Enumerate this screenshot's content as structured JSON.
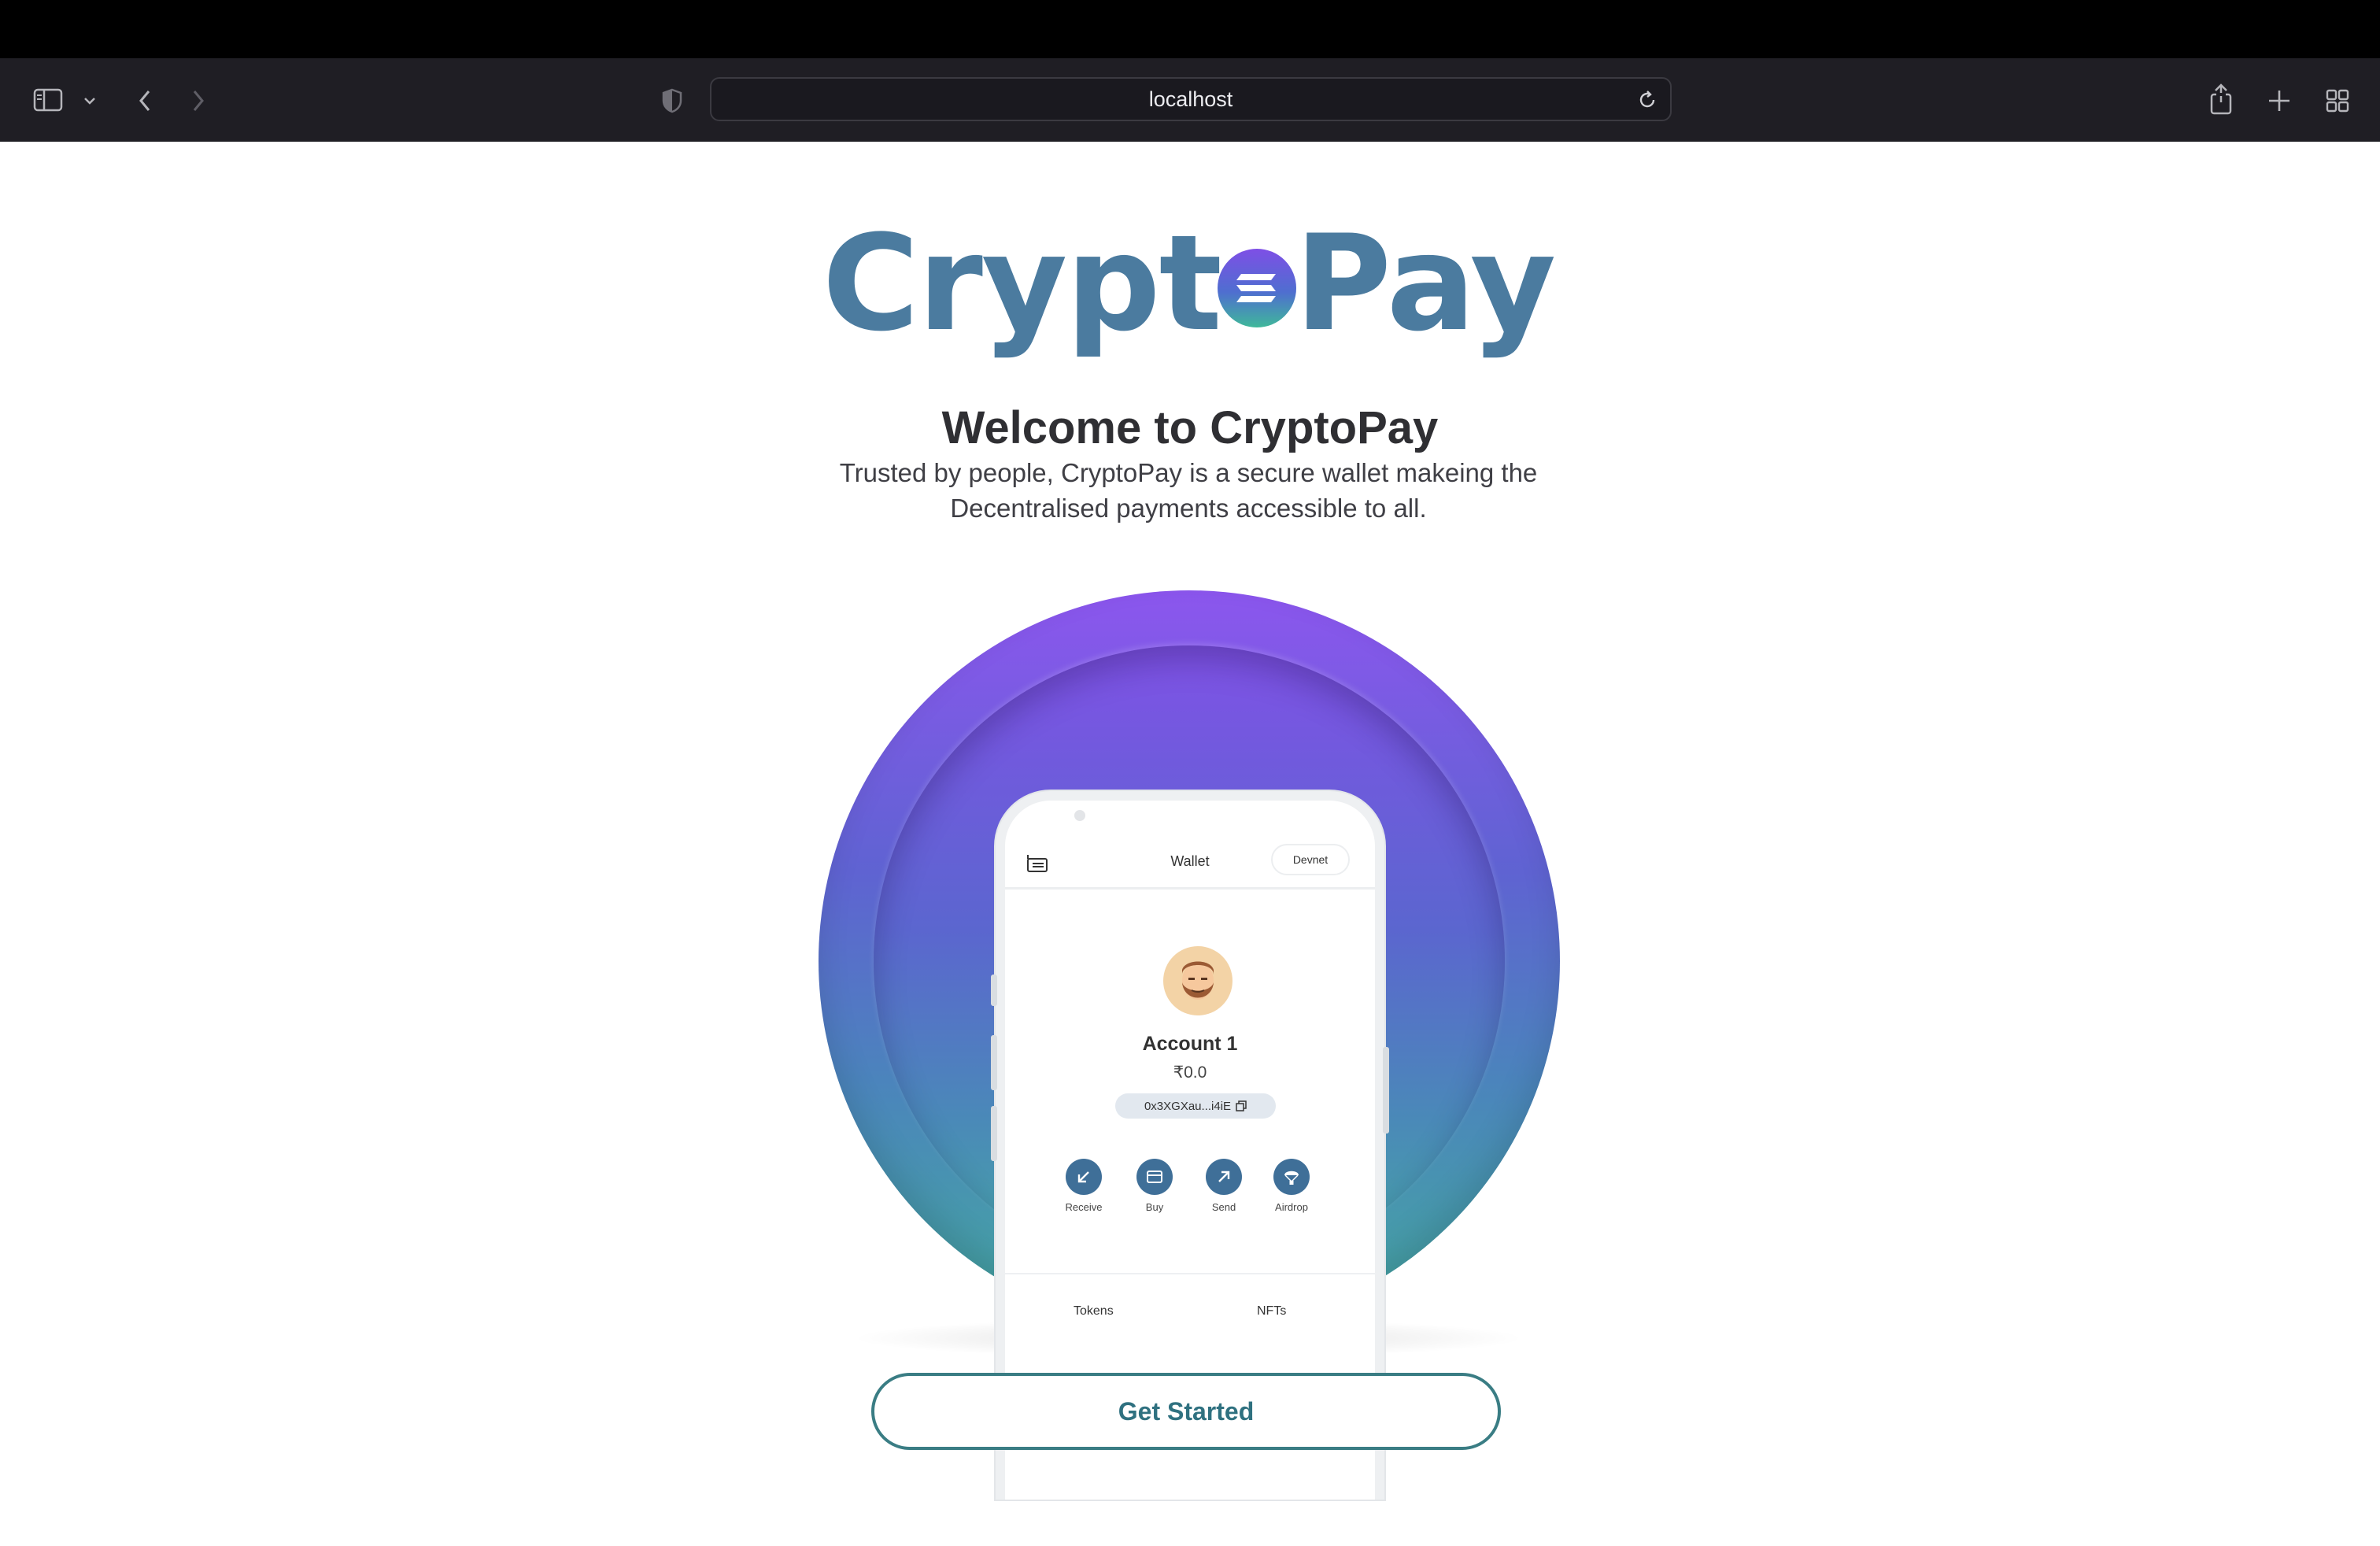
{
  "browser": {
    "address": "localhost"
  },
  "hero": {
    "logo_left": "Crypt",
    "logo_right": "Pay",
    "title": "Welcome to CryptoPay",
    "subtitle_line1": "Trusted by people, CryptoPay is a secure wallet makeing the",
    "subtitle_line2": "Decentralised payments accessible to all."
  },
  "phone": {
    "title": "Wallet",
    "network": "Devnet",
    "account_name": "Account 1",
    "balance": "₹0.0",
    "address": "0x3XGXau...i4iE",
    "actions": [
      {
        "label": "Receive",
        "icon": "arrow-down-left-icon"
      },
      {
        "label": "Buy",
        "icon": "card-icon"
      },
      {
        "label": "Send",
        "icon": "arrow-up-right-icon"
      },
      {
        "label": "Airdrop",
        "icon": "parachute-icon"
      }
    ],
    "tabs": [
      "Tokens",
      "NFTs"
    ]
  },
  "cta": {
    "label": "Get Started"
  },
  "colors": {
    "brand_blue": "#4b7b9f",
    "button_teal": "#3a7d84",
    "coin_top": "#8c56ee",
    "coin_bottom": "#44a9a0"
  }
}
